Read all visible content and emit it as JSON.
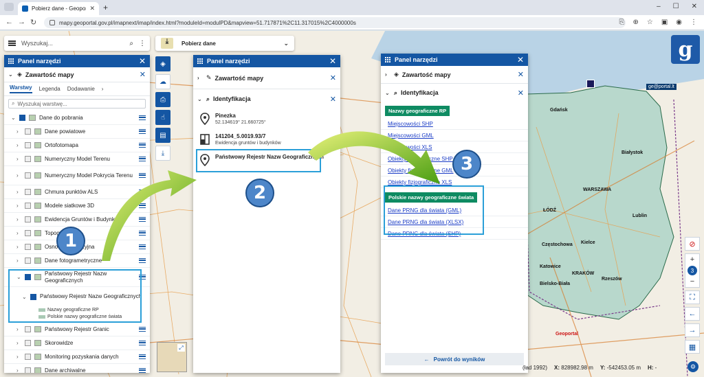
{
  "browser": {
    "tab_title": "Pobierz dane - Geoportal - GUGIK",
    "url": "mapy.geoportal.gov.pl/imapnext/imap/index.html?moduleId=modulPD&mapview=51.717871%2C11.317015%2C4000000s"
  },
  "app": {
    "search_placeholder": "Wyszukaj...",
    "module_label": "Pobierz dane",
    "logo_glyph": "g",
    "geoportal_lt": "ge@portal.lt",
    "geoportal_mini": "Geoportal"
  },
  "panel1": {
    "title": "Panel narzędzi",
    "section": "Zawartość mapy",
    "tabs": [
      "Warstwy",
      "Legenda",
      "Dodawanie"
    ],
    "layer_search_placeholder": "Wyszukaj warstwę...",
    "group": "Dane do pobrania",
    "layers": [
      "Dane powiatowe",
      "Ortofotomapa",
      "Numeryczny Model Terenu",
      "Numeryczny Model Pokrycia Terenu",
      "Chmura punktów ALS",
      "Modele siatkowe 3D",
      "Ewidencja Gruntów i Budynków",
      "Topografia",
      "Osnowa geodezyjna",
      "Dane fotogrametryczne"
    ],
    "prng": "Państwowy Rejestr Nazw Geograficznych",
    "prng_sub": "Państwowy Rejestr Nazw Geograficznych",
    "prng_items": [
      "Nazwy geograficzne RP",
      "Polskie nazwy geograficzne świata"
    ],
    "after": [
      "Państwowy Rejestr Granic",
      "Skorowidze",
      "Monitoring pozyskania danych",
      "Dane archiwalne"
    ]
  },
  "panel2": {
    "title": "Panel narzędzi",
    "section1": "Zawartość mapy",
    "section2": "Identyfikacja",
    "items": [
      {
        "title": "Pinezka",
        "sub": "52.134619° 21.660725°"
      },
      {
        "title": "141204_5.0019.93/7",
        "sub": "Ewidencja gruntów i budynków"
      },
      {
        "title": "Państwowy Rejestr Nazw Geograficznych",
        "sub": ""
      }
    ]
  },
  "panel3": {
    "title": "Panel narzędzi",
    "section1": "Zawartość mapy",
    "section2": "Identyfikacja",
    "group1": "Nazwy geograficzne RP",
    "links1": [
      "Miejscowości SHP",
      "Miejscowości GML",
      "Miejscowości XLS",
      "Obiekty fizjograficzne SHP",
      "Obiekty fizjograficzne GML",
      "Obiekty fizjograficzne XLS"
    ],
    "group2": "Polskie nazwy geograficzne świata",
    "links2": [
      "Dane PRNG dla świata (GML)",
      "Dane PRNG dla świata (XLSX)",
      "Dane PRNG dla świata (SHP)"
    ],
    "back": "Powrót do wyników"
  },
  "badges": [
    "1",
    "2",
    "3"
  ],
  "map_labels": [
    "Gdańsk",
    "Białystok",
    "WARSZAWA",
    "ŁÓDŹ",
    "Kielce",
    "Częstochowa",
    "Katowice",
    "KRAKÓW",
    "Rzeszów",
    "Bielsko-Biała",
    "Lublin"
  ],
  "zoom_level": "3",
  "status": {
    "crs_fragment": "(ład 1992)",
    "x_label": "X:",
    "x_value": "828982.98 m",
    "y_label": "Y:",
    "y_value": "-542453.05 m",
    "h_label": "H:",
    "h_value": "-"
  },
  "colors": {
    "accent": "#1456a3",
    "arrow": "#7bc81e",
    "highlight": "#2a9fd8",
    "badge": "#4d86c9",
    "green_label": "#0e8b62"
  }
}
